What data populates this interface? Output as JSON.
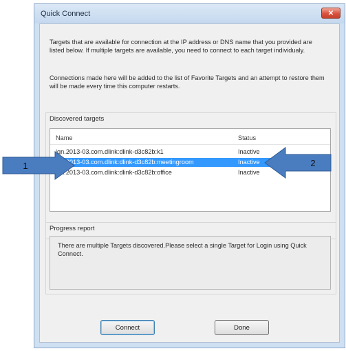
{
  "window": {
    "title": "Quick Connect",
    "close_glyph": "✕"
  },
  "info": {
    "paragraph1": "Targets that are available for connection at the IP address or DNS name that you provided are listed below.  If multiple targets are available, you need to connect to each target individualy.",
    "paragraph2": "Connections made here will be added to the list of Favorite Targets and an attempt to restore them will be made every time this computer restarts."
  },
  "discovered": {
    "label": "Discovered targets",
    "columns": {
      "name": "Name",
      "status": "Status"
    },
    "rows": [
      {
        "name": "iqn.2013-03.com.dlink:dlink-d3c82b:k1",
        "status": "Inactive",
        "selected": false
      },
      {
        "name": "iqn.2013-03.com.dlink:dlink-d3c82b:meetingroom",
        "status": "Inactive",
        "selected": true
      },
      {
        "name": "iqn.2013-03.com.dlink:dlink-d3c82b:office",
        "status": "Inactive",
        "selected": false
      }
    ]
  },
  "progress": {
    "label": "Progress report",
    "text": "There are multiple Targets discovered.Please select a single Target for Login using Quick Connect."
  },
  "buttons": {
    "connect": "Connect",
    "done": "Done"
  },
  "annotations": {
    "callout1": "1",
    "callout2": "2",
    "arrow_color": "#4a7cc0"
  }
}
